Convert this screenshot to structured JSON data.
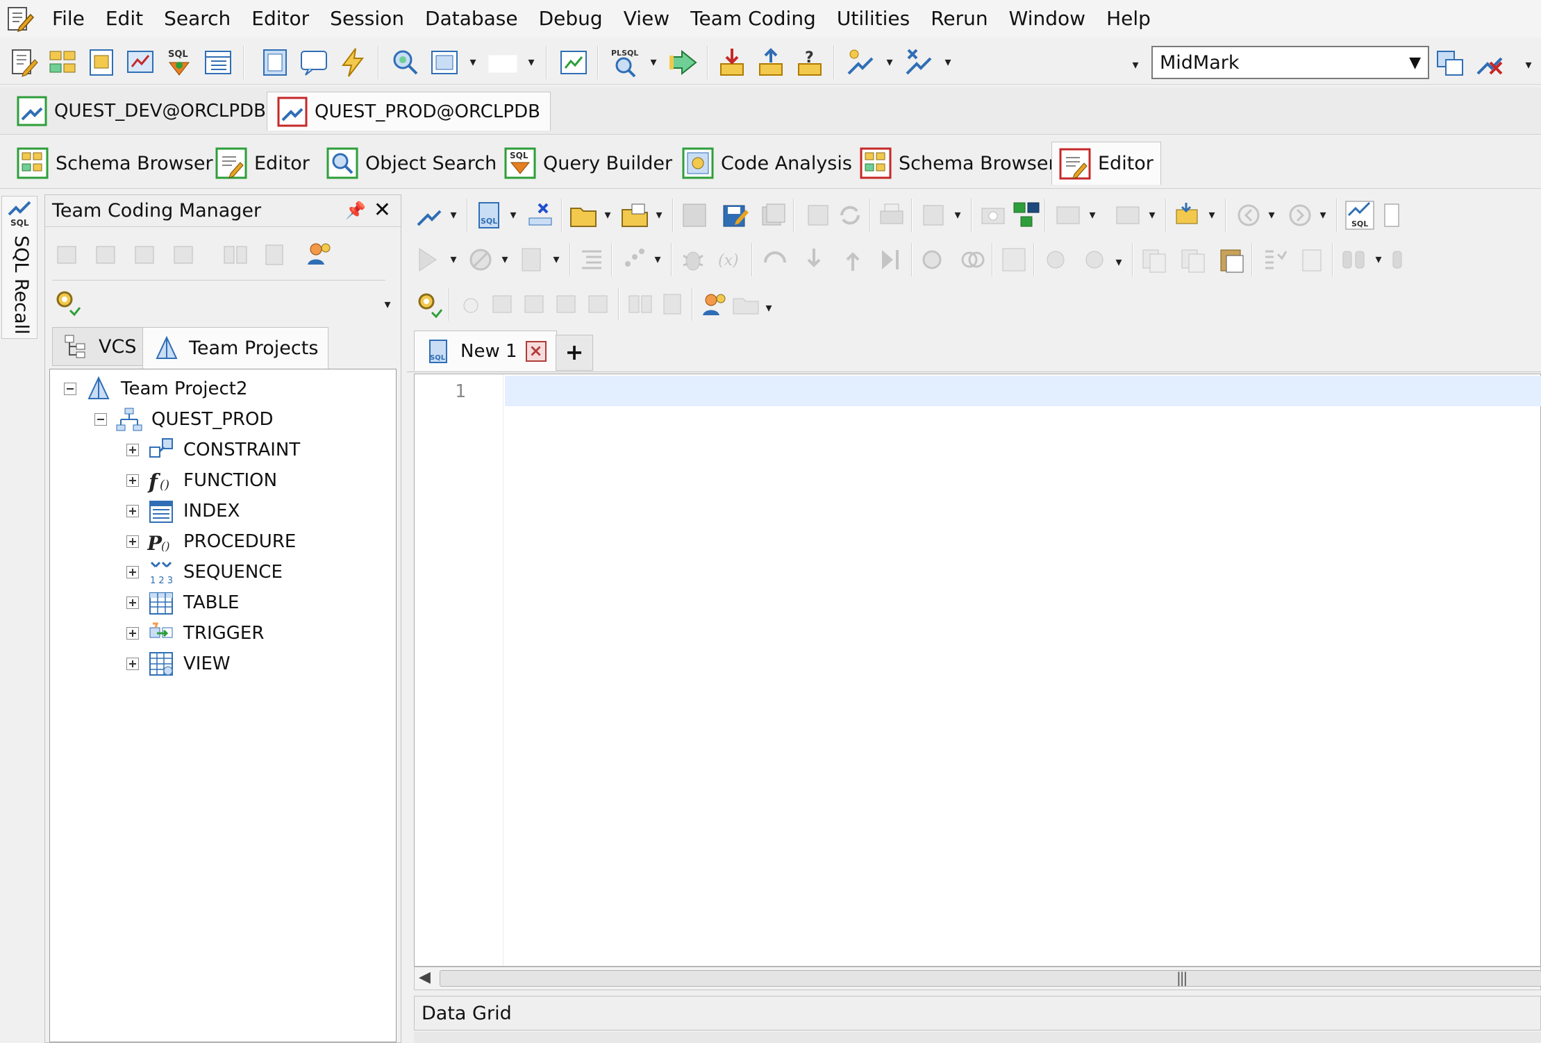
{
  "menu": {
    "items": [
      "File",
      "Edit",
      "Search",
      "Editor",
      "Session",
      "Database",
      "Debug",
      "View",
      "Team Coding",
      "Utilities",
      "Rerun",
      "Window",
      "Help"
    ]
  },
  "toolbar": {
    "connection_value": "MidMark"
  },
  "connections": {
    "tabs": [
      {
        "label": "QUEST_DEV@ORCLPDB",
        "color": "#2e9e3a"
      },
      {
        "label": "QUEST_PROD@ORCLPDB",
        "color": "#c62828"
      }
    ]
  },
  "window_tabs": [
    "Schema Browser",
    "Editor",
    "Object Search",
    "Query Builder",
    "Code Analysis",
    "Schema Browser",
    "Editor"
  ],
  "sidebar": {
    "sql_recall_label": "SQL Recall"
  },
  "team_coding": {
    "title": "Team Coding Manager",
    "tabs": [
      "VCS",
      "Team Projects"
    ],
    "tree": {
      "root": "Team Project2",
      "schema": "QUEST_PROD",
      "items": [
        "CONSTRAINT",
        "FUNCTION",
        "INDEX",
        "PROCEDURE",
        "SEQUENCE",
        "TABLE",
        "TRIGGER",
        "VIEW"
      ]
    }
  },
  "editor": {
    "doc_tab_label": "New 1",
    "new_tab_symbol": "+",
    "line_number": "1",
    "data_grid_label": "Data Grid"
  },
  "colors": {
    "accent_green": "#2e9e3a",
    "accent_red": "#c62828",
    "current_line": "#e3efff"
  }
}
